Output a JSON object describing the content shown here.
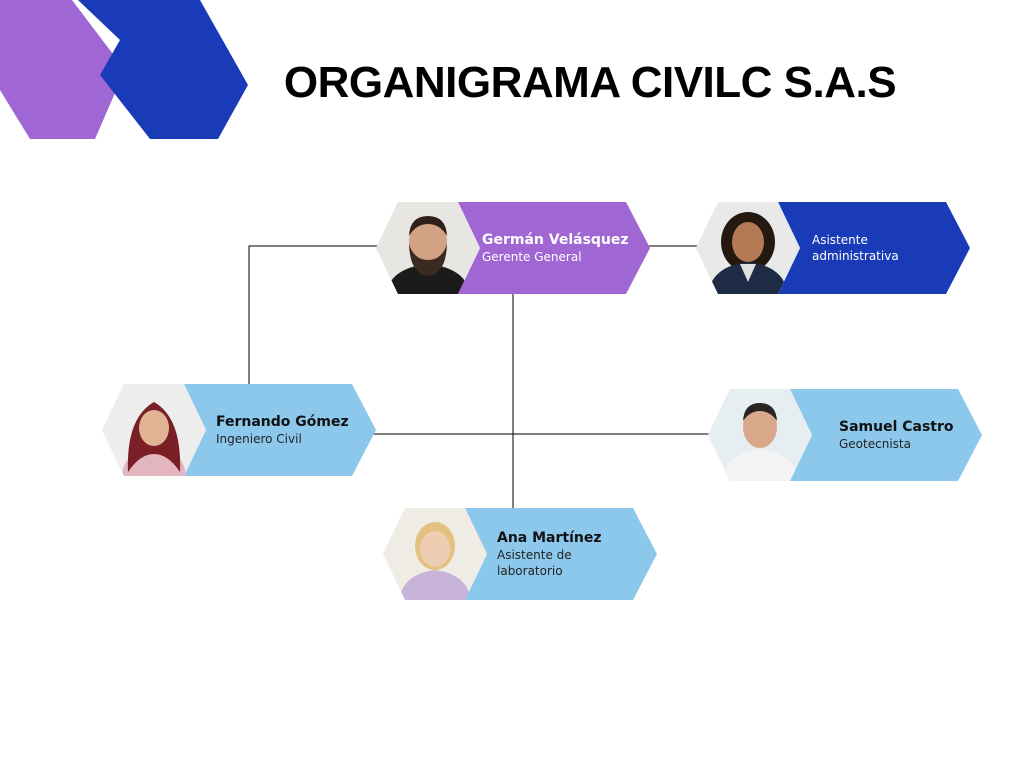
{
  "title": "ORGANIGRAMA CIVILC S.A.S",
  "colors": {
    "purple": "#A066D3",
    "royal_blue": "#1A3BB8",
    "light_blue": "#8CC8EC",
    "connector": "#000000"
  },
  "nodes": [
    {
      "id": "german",
      "name": "Germán Velásquez",
      "role": "Gerente General",
      "color": "#A066D3",
      "photo": "man-beard-photo"
    },
    {
      "id": "asistente-admin",
      "name": "",
      "role": "Asistente administrativa",
      "color": "#1A3BB8",
      "photo": "woman-curly-hair-photo"
    },
    {
      "id": "fernando",
      "name": "Fernando Gómez",
      "role": "Ingeniero Civil",
      "color": "#8CC8EC",
      "photo": "woman-hijab-photo"
    },
    {
      "id": "samuel",
      "name": "Samuel Castro",
      "role": "Geotecnista",
      "color": "#8CC8EC",
      "photo": "man-polo-photo"
    },
    {
      "id": "ana",
      "name": "Ana Martínez",
      "role": "Asistente de laboratorio",
      "color": "#8CC8EC",
      "photo": "woman-blonde-photo"
    }
  ]
}
